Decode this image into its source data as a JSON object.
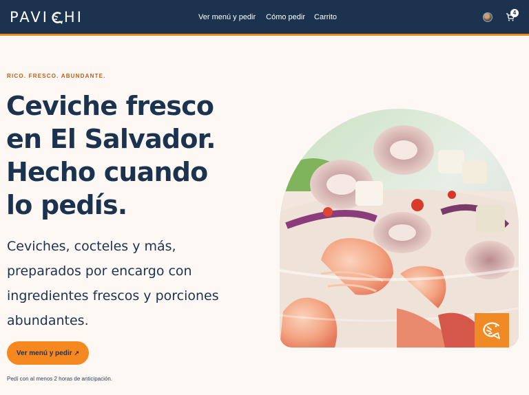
{
  "brand": {
    "logo_left": "PAVI",
    "logo_right": "HI"
  },
  "nav": {
    "links": [
      "Ver menú y pedir",
      "Cómo pedir",
      "Carrito"
    ],
    "cart_count": "4"
  },
  "hero": {
    "eyebrow": "RICO. FRESCO. ABUNDANTE.",
    "headline": "Ceviche fresco en El Salvador. Hecho cuando lo pedís.",
    "subtext": "Ceviches, cocteles y más, preparados por encargo con ingredientes frescos y porciones abundantes.",
    "cta_label": "Ver menú y pedir",
    "cta_icon": "arrow-up-right-icon",
    "note": "Pedí con al menos 2 horas de anticipación."
  },
  "colors": {
    "navy": "#1c3350",
    "accent": "#f08a24",
    "background": "#fdf8f3",
    "eyebrow": "#c45a12"
  },
  "icons": [
    "shrimp-icon",
    "avatar",
    "cart-icon",
    "arrow-up-right-icon"
  ]
}
